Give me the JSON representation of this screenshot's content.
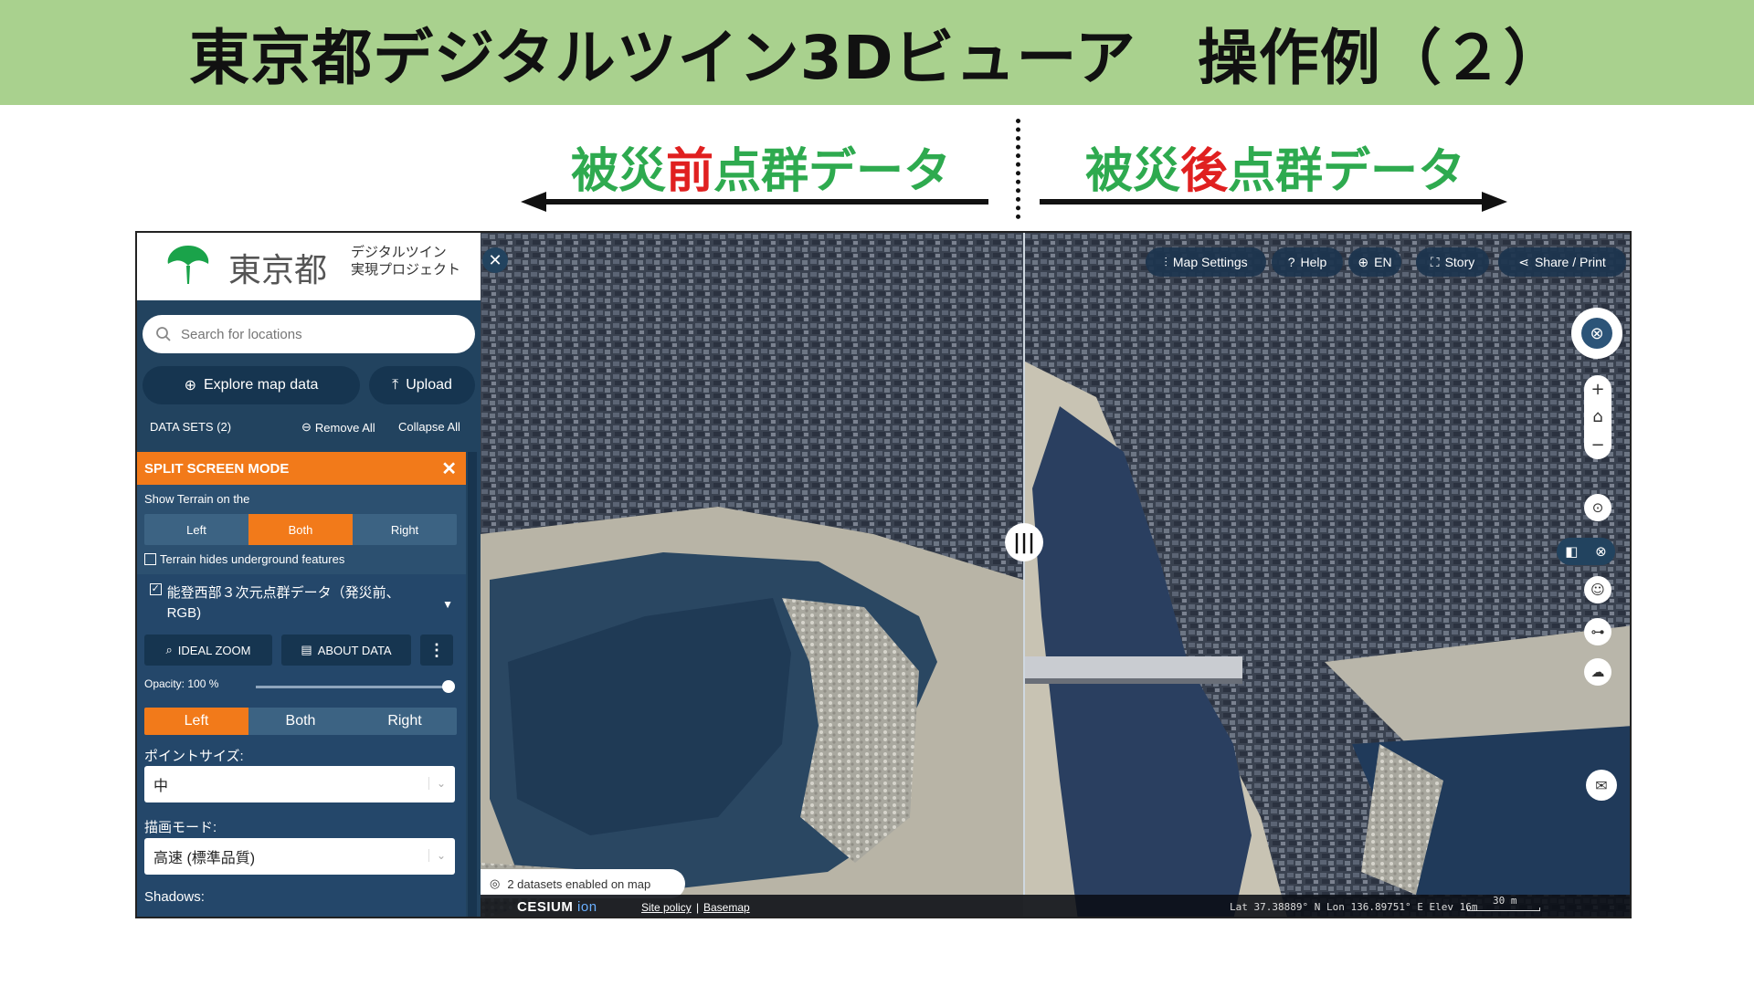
{
  "slide": {
    "title": "東京都デジタルツイン3Dビューア　操作例（２）",
    "before_label_pre": "被災",
    "before_label_emph": "前",
    "before_label_post": "点群データ",
    "after_label_pre": "被災",
    "after_label_emph": "後",
    "after_label_post": "点群データ"
  },
  "brand": {
    "name": "東京都",
    "sub_line1": "デジタルツイン",
    "sub_line2": "実現プロジェクト",
    "logo_color": "#1aa34a"
  },
  "search": {
    "placeholder": "Search for locations"
  },
  "buttons": {
    "explore": "Explore map data",
    "upload": "Upload"
  },
  "datasets": {
    "title": "DATA SETS (2)",
    "remove_all": "Remove All",
    "collapse_all": "Collapse All"
  },
  "split": {
    "title": "SPLIT SCREEN MODE",
    "terrain_label": "Show Terrain on the",
    "terrain_options": [
      "Left",
      "Both",
      "Right"
    ],
    "terrain_selected": "Both",
    "terrain_hides": "Terrain hides underground features",
    "terrain_hides_checked": false
  },
  "layer": {
    "title": "能登西部３次元点群データ（発災前、RGB)",
    "checked": true,
    "ideal_zoom": "IDEAL ZOOM",
    "about_data": "ABOUT DATA",
    "opacity_label": "Opacity: 100 %",
    "opacity": 1.0,
    "side_options": [
      "Left",
      "Both",
      "Right"
    ],
    "side_selected": "Left",
    "point_size_label": "ポイントサイズ:",
    "point_size_value": "中",
    "render_mode_label": "描画モード:",
    "render_mode_value": "高速 (標準品質)",
    "shadows_label": "Shadows:"
  },
  "topnav": {
    "map_settings": "Map Settings",
    "help": "Help",
    "lang": "EN",
    "story": "Story",
    "share": "Share / Print"
  },
  "map": {
    "datasets_enabled": "2 datasets enabled on map",
    "cesium": "CESIUM",
    "ion": "ion",
    "site_policy": "Site policy",
    "basemap": "Basemap",
    "coords": "Lat  37.38889° N    Lon  136.89751° E    Elev  16m",
    "scale": "30 m"
  },
  "colors": {
    "header_bg": "#a9d18e",
    "label_green": "#2eaa4f",
    "label_red": "#e02020",
    "accent_orange": "#f27a1a",
    "sidebar_bg": "#22435f"
  }
}
